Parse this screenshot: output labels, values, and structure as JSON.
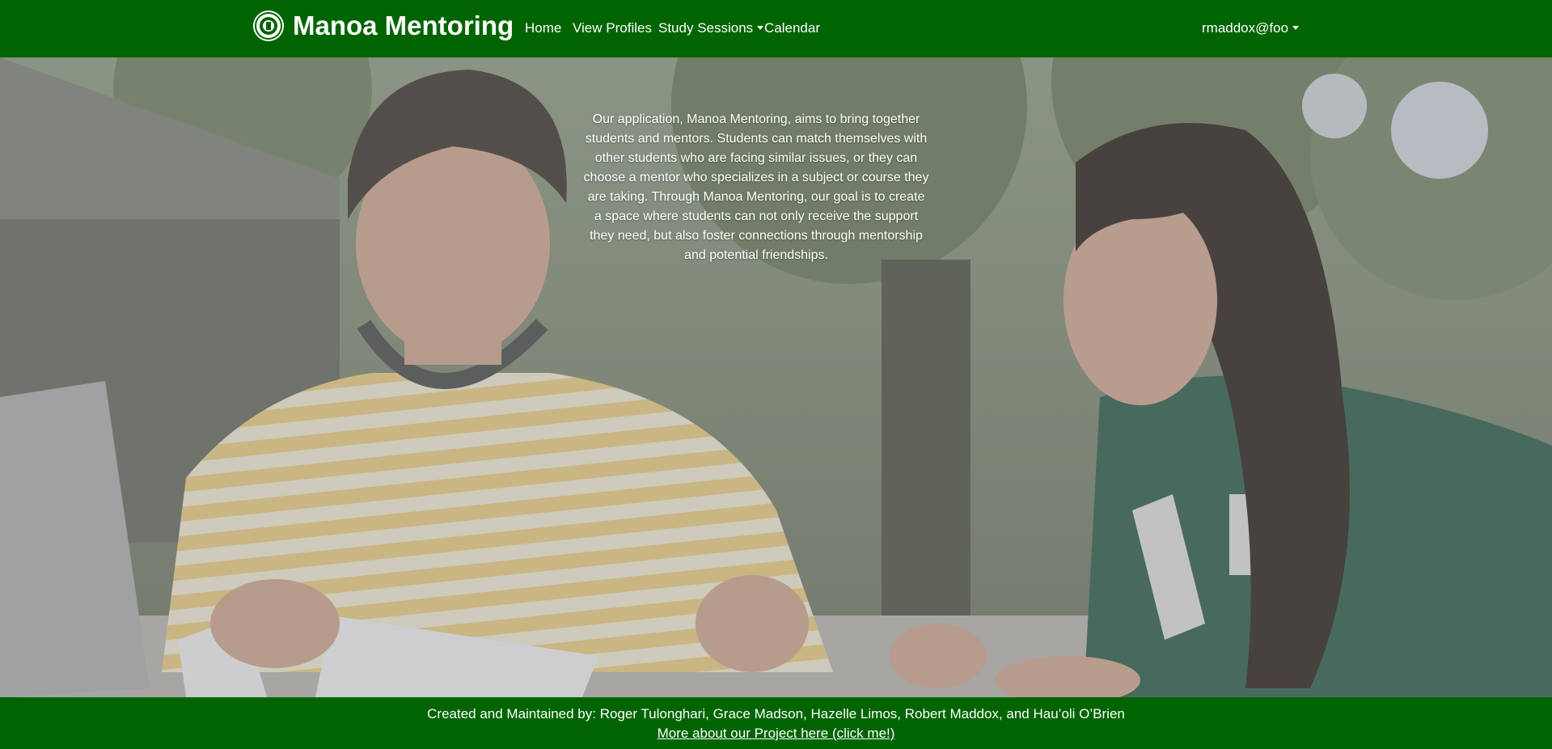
{
  "navbar": {
    "brand": "Manoa Mentoring",
    "brand_icon": "uh-seal-logo",
    "links": {
      "home": "Home",
      "view_profiles": "View Profiles",
      "study_sessions": "Study Sessions",
      "calendar": "Calendar"
    },
    "user": "rmaddox@foo",
    "color": "#006400"
  },
  "hero": {
    "description": "Our application, Manoa Mentoring, aims to bring together students and mentors. Students can match themselves with other students who are facing similar issues, or they can choose a mentor who specializes in a subject or course they are taking. Through Manoa Mentoring, our goal is to create a space where students can not only receive the support they need, but also foster connections through mentorship and potential friendships."
  },
  "footer": {
    "credits": "Created and Maintained by: Roger Tulonghari, Grace Madson, Hazelle Limos, Robert Maddox, and Hau’oli O’Brien",
    "project_link": "More about our Project here (click me!)",
    "color": "#006400"
  }
}
